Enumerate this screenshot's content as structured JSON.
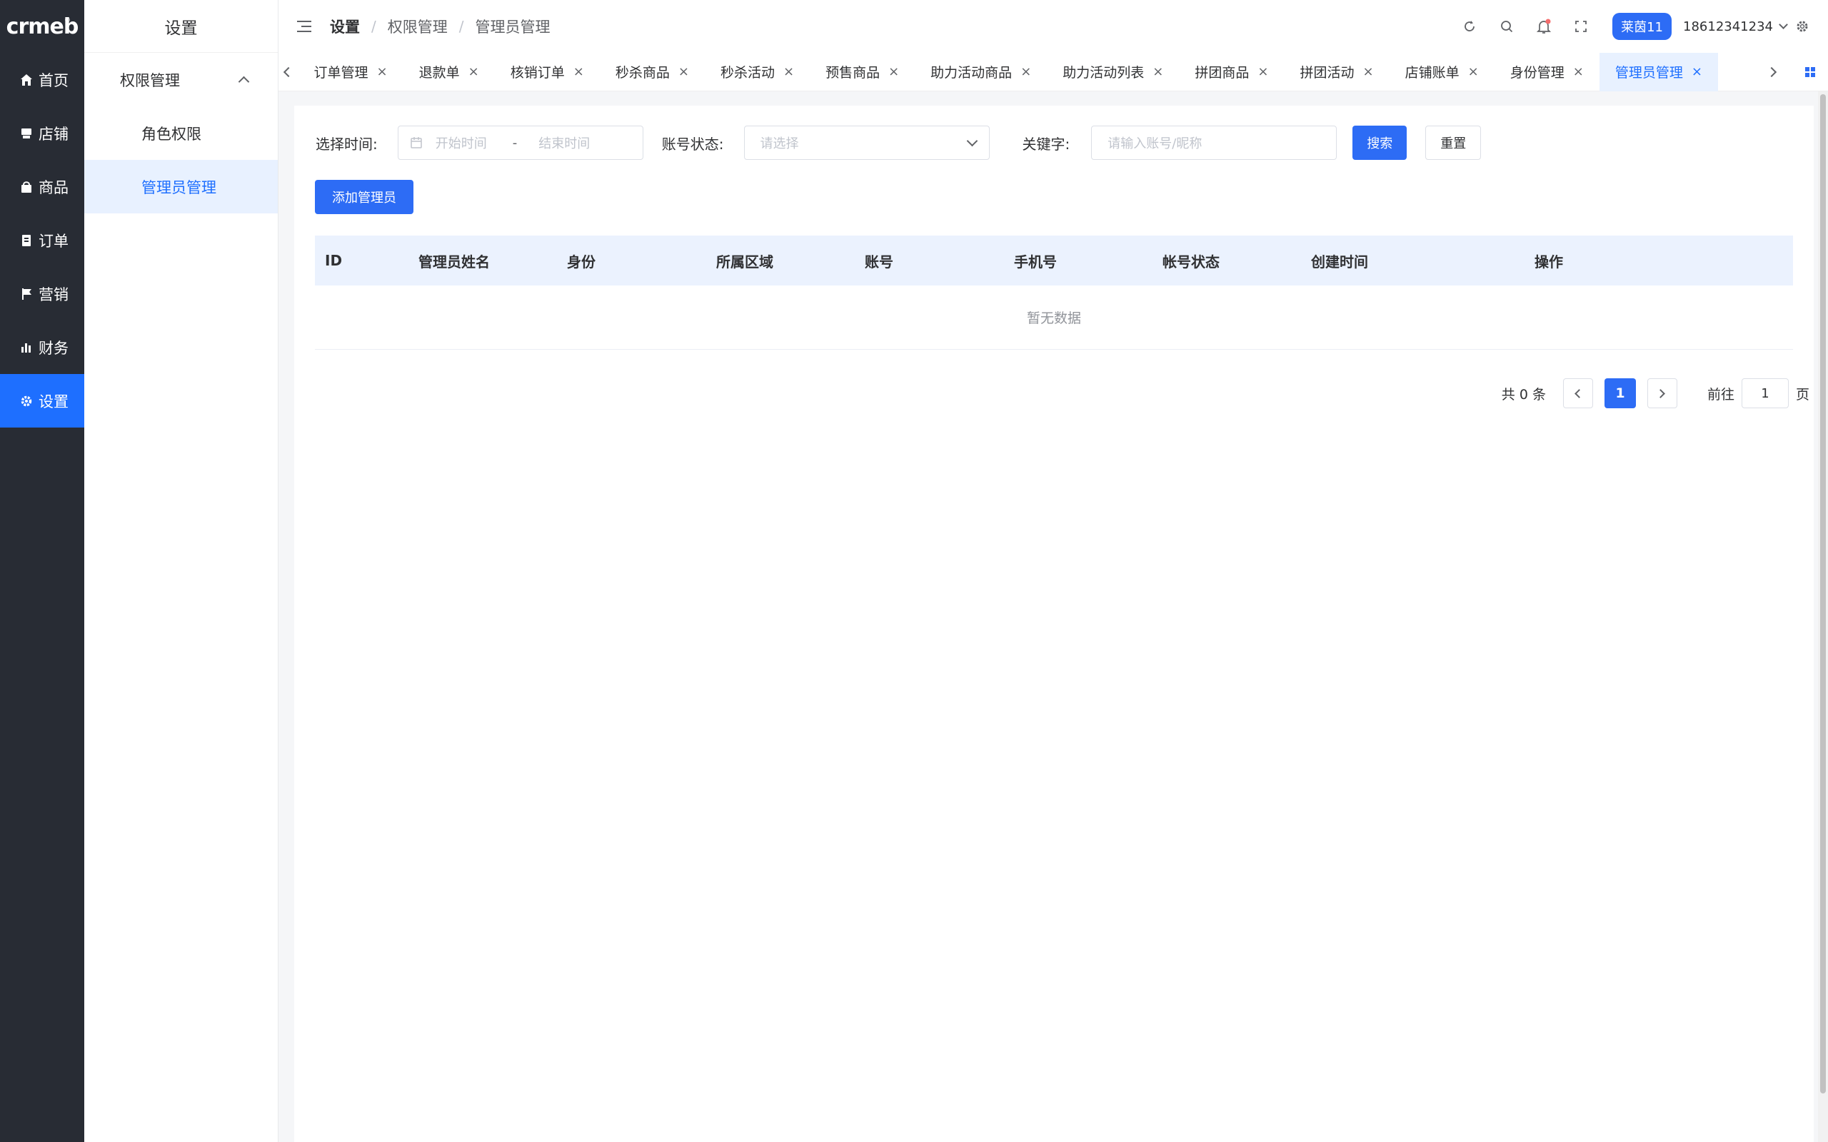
{
  "brand": {
    "logo_text": "crmeb",
    "logo_mark": "®"
  },
  "rail": {
    "items": [
      {
        "label": "首页",
        "icon": "home-icon"
      },
      {
        "label": "店铺",
        "icon": "store-icon"
      },
      {
        "label": "商品",
        "icon": "bag-icon"
      },
      {
        "label": "订单",
        "icon": "order-icon"
      },
      {
        "label": "营销",
        "icon": "flag-icon"
      },
      {
        "label": "财务",
        "icon": "bar-chart-icon"
      },
      {
        "label": "设置",
        "icon": "gear-icon",
        "active": true
      }
    ]
  },
  "submenu": {
    "title": "设置",
    "group": "权限管理",
    "items": [
      {
        "label": "角色权限"
      },
      {
        "label": "管理员管理",
        "active": true
      }
    ]
  },
  "header": {
    "breadcrumb": [
      "设置",
      "权限管理",
      "管理员管理"
    ],
    "user_badge": "莱茵11",
    "account": "18612341234"
  },
  "tabs": [
    {
      "label": "订单管理"
    },
    {
      "label": "退款单"
    },
    {
      "label": "核销订单"
    },
    {
      "label": "秒杀商品"
    },
    {
      "label": "秒杀活动"
    },
    {
      "label": "预售商品"
    },
    {
      "label": "助力活动商品"
    },
    {
      "label": "助力活动列表"
    },
    {
      "label": "拼团商品"
    },
    {
      "label": "拼团活动"
    },
    {
      "label": "店铺账单"
    },
    {
      "label": "身份管理"
    },
    {
      "label": "管理员管理",
      "active": true
    }
  ],
  "filters": {
    "time_label": "选择时间:",
    "start_placeholder": "开始时间",
    "range_sep": "-",
    "end_placeholder": "结束时间",
    "status_label": "账号状态:",
    "status_placeholder": "请选择",
    "keyword_label": "关键字:",
    "keyword_placeholder": "请输入账号/昵称",
    "search_label": "搜索",
    "reset_label": "重置"
  },
  "add_button_label": "添加管理员",
  "table": {
    "columns": [
      "ID",
      "管理员姓名",
      "身份",
      "所属区域",
      "账号",
      "手机号",
      "帐号状态",
      "创建时间",
      "操作"
    ],
    "empty_text": "暂无数据"
  },
  "pagination": {
    "total_text": "共 0 条",
    "current_page": "1",
    "goto_label": "前往",
    "goto_value": "1",
    "page_unit": "页"
  },
  "colors": {
    "rail_bg": "#282c34",
    "accent": "#2d6cf5",
    "active_bg": "#e8f1ff",
    "table_head_bg": "#ebf2fe",
    "notify_dot": "#f56c6c"
  }
}
